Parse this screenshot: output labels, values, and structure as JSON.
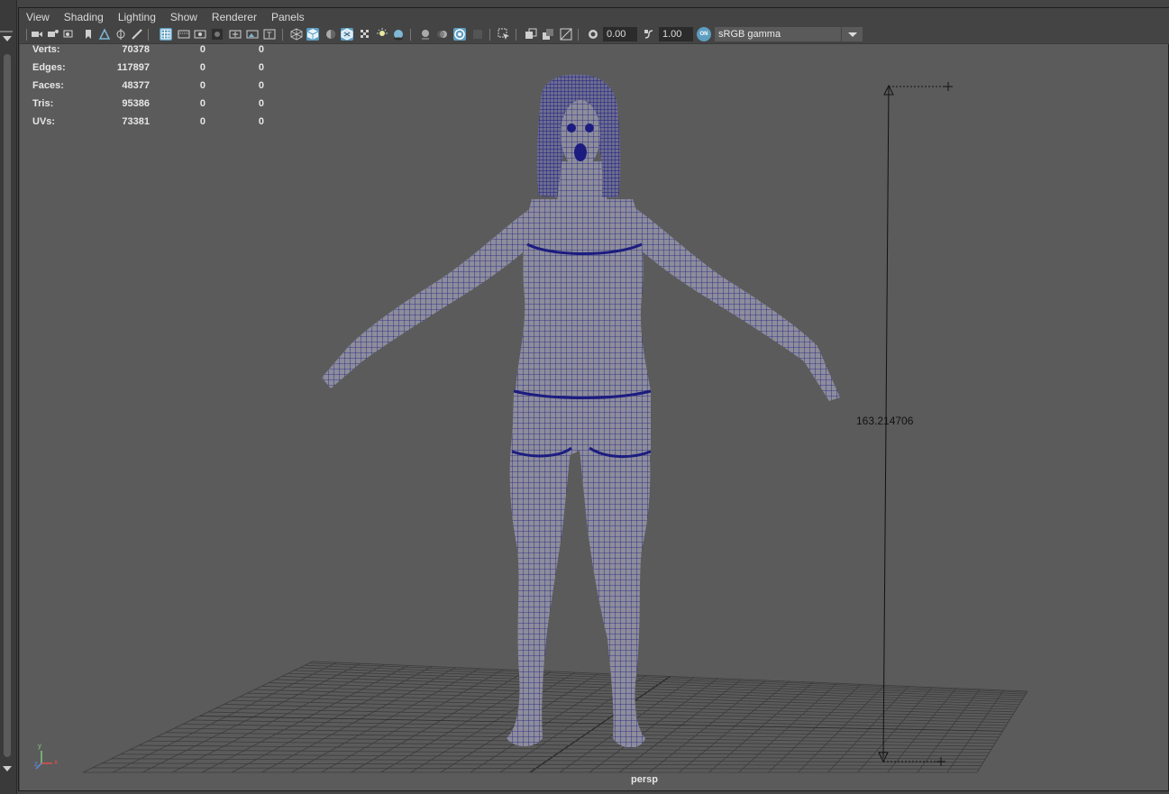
{
  "menubar": {
    "items": [
      {
        "label": "View"
      },
      {
        "label": "Shading"
      },
      {
        "label": "Lighting"
      },
      {
        "label": "Show"
      },
      {
        "label": "Renderer"
      },
      {
        "label": "Panels"
      }
    ]
  },
  "toolbar": {
    "exposure_value": "0.00",
    "gamma_value": "1.00",
    "color_mgmt_badge": "ON",
    "color_space": "sRGB gamma"
  },
  "hud": {
    "rows": [
      {
        "label": "Verts:",
        "total": "70378",
        "selected": "0",
        "uv": "0"
      },
      {
        "label": "Edges:",
        "total": "117897",
        "selected": "0",
        "uv": "0"
      },
      {
        "label": "Faces:",
        "total": "48377",
        "selected": "0",
        "uv": "0"
      },
      {
        "label": "Tris:",
        "total": "95386",
        "selected": "0",
        "uv": "0"
      },
      {
        "label": "UVs:",
        "total": "73381",
        "selected": "0",
        "uv": "0"
      }
    ]
  },
  "viewport": {
    "camera": "persp",
    "dimension": "163.214706",
    "axis_y": "y",
    "axis_z": "z",
    "axis_x": "x",
    "mesh_color": "#1c1c80",
    "mesh_fill": "#8a8a9a",
    "background": "#5b5b5b",
    "accent": "#5d9ec0"
  }
}
